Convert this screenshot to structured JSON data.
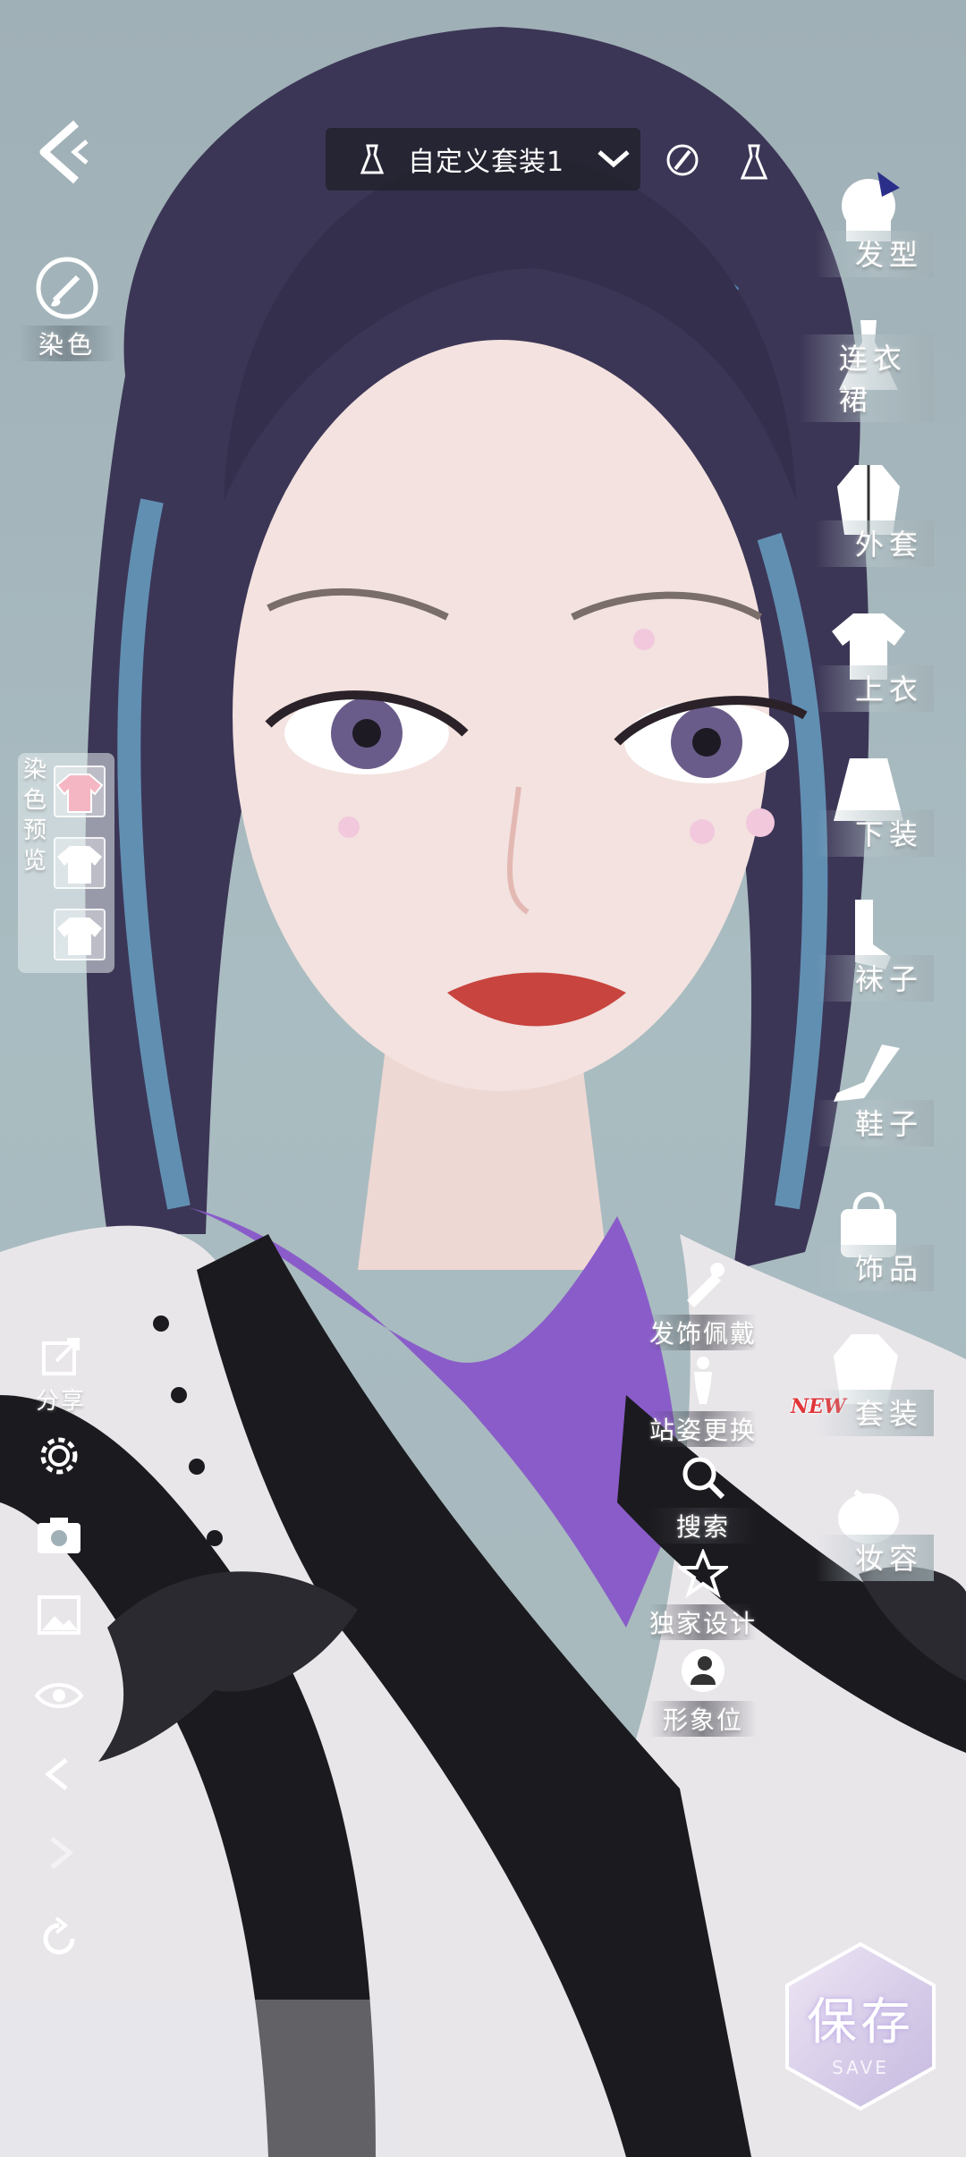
{
  "top_bar": {
    "outfit_name": "自定义套装1"
  },
  "left_panel": {
    "dye_label": "染色",
    "dye_preview_label": [
      "染",
      "色",
      "预",
      "览"
    ],
    "share_label": "分享"
  },
  "categories": [
    {
      "label": "发型"
    },
    {
      "label": "连衣裙"
    },
    {
      "label": "外套"
    },
    {
      "label": "上衣"
    },
    {
      "label": "下装"
    },
    {
      "label": "袜子"
    },
    {
      "label": "鞋子"
    },
    {
      "label": "饰品"
    },
    {
      "label": "套装",
      "badge": "NEW"
    },
    {
      "label": "妆容"
    }
  ],
  "actions": [
    {
      "label": "发饰佩戴",
      "icon": "hair-clip-icon"
    },
    {
      "label": "站姿更换",
      "icon": "pose-figure-icon"
    },
    {
      "label": "搜索",
      "icon": "search-icon"
    },
    {
      "label": "独家设计",
      "icon": "star-icon"
    },
    {
      "label": "形象位",
      "icon": "portrait-icon"
    }
  ],
  "save_label": "保存",
  "save_sub": "SAVE",
  "colors": {
    "panel_dark": "#1e1e26",
    "new_badge": "#e0363a",
    "dye_swatch_active": "#f4b6c2"
  }
}
